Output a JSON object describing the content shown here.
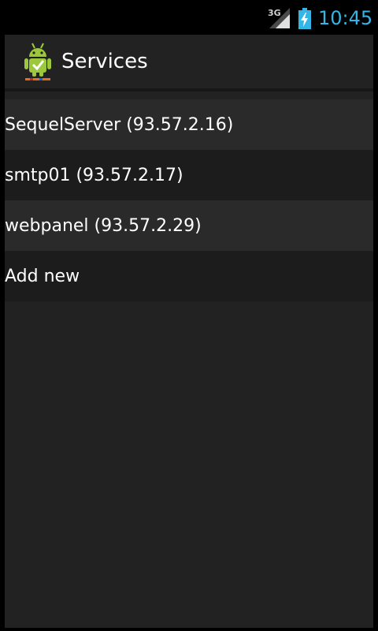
{
  "status_bar": {
    "network": "3G",
    "time": "10:45",
    "colors": {
      "clock": "#33b5e5"
    },
    "icons": [
      "signal-strength-icon",
      "battery-charging-icon"
    ]
  },
  "action_bar": {
    "title": "Services",
    "icon": "android-app-icon"
  },
  "services": [
    {
      "label": "SequelServer (93.57.2.16)"
    },
    {
      "label": "smtp01 (93.57.2.17)"
    },
    {
      "label": "webpanel (93.57.2.29)"
    },
    {
      "label": "Add new"
    }
  ]
}
